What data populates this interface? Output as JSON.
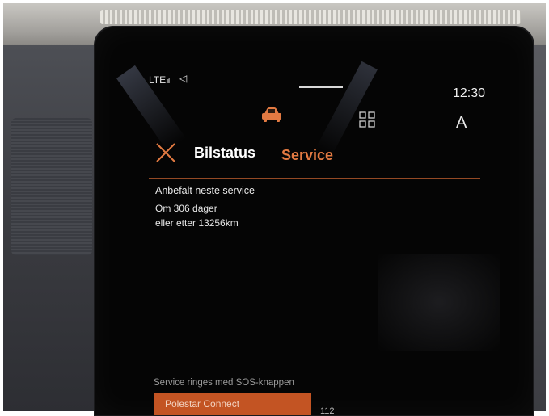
{
  "status_bar": {
    "network": "LTE",
    "time": "12:30"
  },
  "top_bar": {
    "profile_letter": "A"
  },
  "header": {
    "title": "Bilstatus",
    "active_tab": "Service"
  },
  "service": {
    "heading": "Anbefalt neste service",
    "days_line": "Om 306 dager",
    "km_line": "eller etter 13256km"
  },
  "footer": {
    "sos_note": "Service ringes med SOS-knappen",
    "connect_button": "Polestar Connect",
    "emergency_number": "112"
  },
  "colors": {
    "accent": "#e37a42",
    "button": "#c35423",
    "background": "#050505"
  },
  "icons": [
    "network-signal-icon",
    "location-arrow-icon",
    "car-icon",
    "app-grid-icon",
    "close-icon"
  ]
}
